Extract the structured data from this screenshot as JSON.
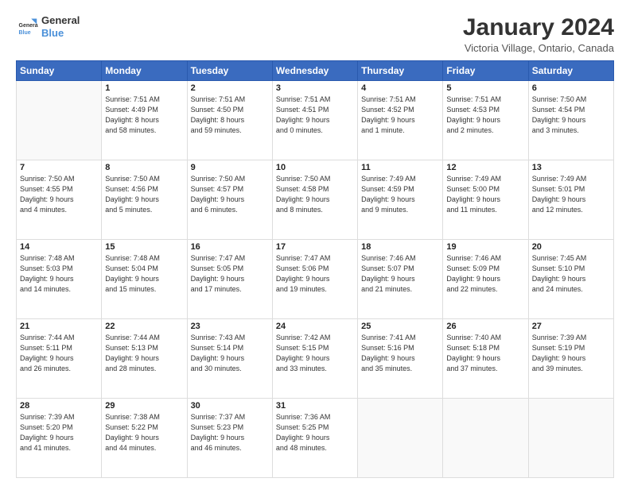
{
  "header": {
    "logo_line1": "General",
    "logo_line2": "Blue",
    "month": "January 2024",
    "location": "Victoria Village, Ontario, Canada"
  },
  "days_of_week": [
    "Sunday",
    "Monday",
    "Tuesday",
    "Wednesday",
    "Thursday",
    "Friday",
    "Saturday"
  ],
  "weeks": [
    [
      {
        "day": "",
        "info": ""
      },
      {
        "day": "1",
        "info": "Sunrise: 7:51 AM\nSunset: 4:49 PM\nDaylight: 8 hours\nand 58 minutes."
      },
      {
        "day": "2",
        "info": "Sunrise: 7:51 AM\nSunset: 4:50 PM\nDaylight: 8 hours\nand 59 minutes."
      },
      {
        "day": "3",
        "info": "Sunrise: 7:51 AM\nSunset: 4:51 PM\nDaylight: 9 hours\nand 0 minutes."
      },
      {
        "day": "4",
        "info": "Sunrise: 7:51 AM\nSunset: 4:52 PM\nDaylight: 9 hours\nand 1 minute."
      },
      {
        "day": "5",
        "info": "Sunrise: 7:51 AM\nSunset: 4:53 PM\nDaylight: 9 hours\nand 2 minutes."
      },
      {
        "day": "6",
        "info": "Sunrise: 7:50 AM\nSunset: 4:54 PM\nDaylight: 9 hours\nand 3 minutes."
      }
    ],
    [
      {
        "day": "7",
        "info": "Sunrise: 7:50 AM\nSunset: 4:55 PM\nDaylight: 9 hours\nand 4 minutes."
      },
      {
        "day": "8",
        "info": "Sunrise: 7:50 AM\nSunset: 4:56 PM\nDaylight: 9 hours\nand 5 minutes."
      },
      {
        "day": "9",
        "info": "Sunrise: 7:50 AM\nSunset: 4:57 PM\nDaylight: 9 hours\nand 6 minutes."
      },
      {
        "day": "10",
        "info": "Sunrise: 7:50 AM\nSunset: 4:58 PM\nDaylight: 9 hours\nand 8 minutes."
      },
      {
        "day": "11",
        "info": "Sunrise: 7:49 AM\nSunset: 4:59 PM\nDaylight: 9 hours\nand 9 minutes."
      },
      {
        "day": "12",
        "info": "Sunrise: 7:49 AM\nSunset: 5:00 PM\nDaylight: 9 hours\nand 11 minutes."
      },
      {
        "day": "13",
        "info": "Sunrise: 7:49 AM\nSunset: 5:01 PM\nDaylight: 9 hours\nand 12 minutes."
      }
    ],
    [
      {
        "day": "14",
        "info": "Sunrise: 7:48 AM\nSunset: 5:03 PM\nDaylight: 9 hours\nand 14 minutes."
      },
      {
        "day": "15",
        "info": "Sunrise: 7:48 AM\nSunset: 5:04 PM\nDaylight: 9 hours\nand 15 minutes."
      },
      {
        "day": "16",
        "info": "Sunrise: 7:47 AM\nSunset: 5:05 PM\nDaylight: 9 hours\nand 17 minutes."
      },
      {
        "day": "17",
        "info": "Sunrise: 7:47 AM\nSunset: 5:06 PM\nDaylight: 9 hours\nand 19 minutes."
      },
      {
        "day": "18",
        "info": "Sunrise: 7:46 AM\nSunset: 5:07 PM\nDaylight: 9 hours\nand 21 minutes."
      },
      {
        "day": "19",
        "info": "Sunrise: 7:46 AM\nSunset: 5:09 PM\nDaylight: 9 hours\nand 22 minutes."
      },
      {
        "day": "20",
        "info": "Sunrise: 7:45 AM\nSunset: 5:10 PM\nDaylight: 9 hours\nand 24 minutes."
      }
    ],
    [
      {
        "day": "21",
        "info": "Sunrise: 7:44 AM\nSunset: 5:11 PM\nDaylight: 9 hours\nand 26 minutes."
      },
      {
        "day": "22",
        "info": "Sunrise: 7:44 AM\nSunset: 5:13 PM\nDaylight: 9 hours\nand 28 minutes."
      },
      {
        "day": "23",
        "info": "Sunrise: 7:43 AM\nSunset: 5:14 PM\nDaylight: 9 hours\nand 30 minutes."
      },
      {
        "day": "24",
        "info": "Sunrise: 7:42 AM\nSunset: 5:15 PM\nDaylight: 9 hours\nand 33 minutes."
      },
      {
        "day": "25",
        "info": "Sunrise: 7:41 AM\nSunset: 5:16 PM\nDaylight: 9 hours\nand 35 minutes."
      },
      {
        "day": "26",
        "info": "Sunrise: 7:40 AM\nSunset: 5:18 PM\nDaylight: 9 hours\nand 37 minutes."
      },
      {
        "day": "27",
        "info": "Sunrise: 7:39 AM\nSunset: 5:19 PM\nDaylight: 9 hours\nand 39 minutes."
      }
    ],
    [
      {
        "day": "28",
        "info": "Sunrise: 7:39 AM\nSunset: 5:20 PM\nDaylight: 9 hours\nand 41 minutes."
      },
      {
        "day": "29",
        "info": "Sunrise: 7:38 AM\nSunset: 5:22 PM\nDaylight: 9 hours\nand 44 minutes."
      },
      {
        "day": "30",
        "info": "Sunrise: 7:37 AM\nSunset: 5:23 PM\nDaylight: 9 hours\nand 46 minutes."
      },
      {
        "day": "31",
        "info": "Sunrise: 7:36 AM\nSunset: 5:25 PM\nDaylight: 9 hours\nand 48 minutes."
      },
      {
        "day": "",
        "info": ""
      },
      {
        "day": "",
        "info": ""
      },
      {
        "day": "",
        "info": ""
      }
    ]
  ]
}
